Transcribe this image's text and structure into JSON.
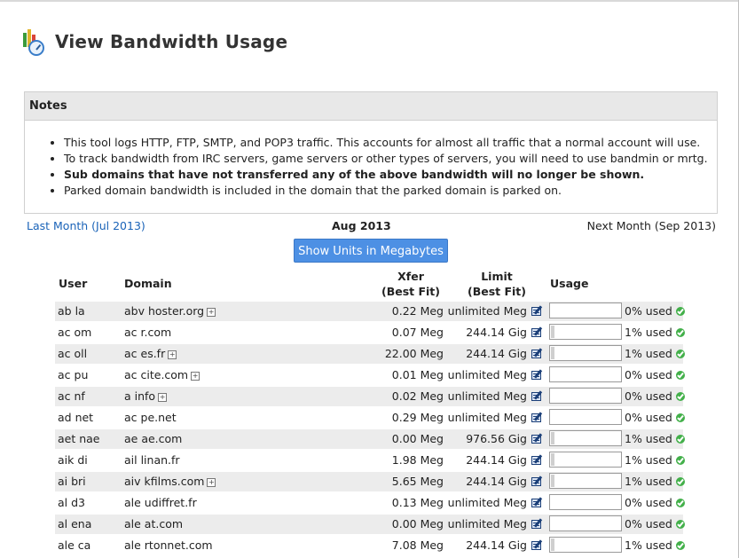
{
  "page": {
    "title": "View Bandwidth Usage",
    "icon": "bandwidth-gauge-icon"
  },
  "notes": {
    "heading": "Notes",
    "items": [
      {
        "text": "This tool logs HTTP, FTP, SMTP, and POP3 traffic. This accounts for almost all traffic that a normal account will use.",
        "bold": false
      },
      {
        "text": "To track bandwidth from IRC servers, game servers or other types of servers, you will need to use bandmin or mrtg.",
        "bold": false
      },
      {
        "text": "Sub domains that have not transferred any of the above bandwidth will no longer be shown.",
        "bold": true
      },
      {
        "text": "Parked domain bandwidth is included in the domain that the parked domain is parked on.",
        "bold": false
      }
    ]
  },
  "month_nav": {
    "prev": "Last Month (Jul 2013)",
    "current": "Aug 2013",
    "next": "Next Month (Sep 2013)"
  },
  "units_button": "Show Units in Megabytes",
  "table": {
    "headers": {
      "user": "User",
      "domain": "Domain",
      "xfer_line1": "Xfer",
      "xfer_line2": "(Best Fit)",
      "limit_line1": "Limit",
      "limit_line2": "(Best Fit)",
      "usage": "Usage"
    },
    "rows": [
      {
        "user": "ab      la",
        "domain": "abv                hoster.org",
        "expandable": true,
        "xfer": "0.22 Meg",
        "limit": "unlimited Meg",
        "usage_fraction": 0.0,
        "pct": "0% used"
      },
      {
        "user": "ac      om",
        "domain": "ac      r.com",
        "expandable": false,
        "xfer": "0.07 Meg",
        "limit": "244.14 Gig",
        "usage_fraction": 0.01,
        "pct": "1% used"
      },
      {
        "user": "ac      oll",
        "domain": "ac            es.fr",
        "expandable": true,
        "xfer": "22.00 Meg",
        "limit": "244.14 Gig",
        "usage_fraction": 0.01,
        "pct": "1% used"
      },
      {
        "user": "ac      pu",
        "domain": "ac              cite.com",
        "expandable": true,
        "xfer": "0.01 Meg",
        "limit": "unlimited Meg",
        "usage_fraction": 0.0,
        "pct": "0% used"
      },
      {
        "user": "ac      nf",
        "domain": "a          info",
        "expandable": true,
        "xfer": "0.02 Meg",
        "limit": "unlimited Meg",
        "usage_fraction": 0.0,
        "pct": "0% used"
      },
      {
        "user": "ad      net",
        "domain": "ac     pe.net",
        "expandable": false,
        "xfer": "0.29 Meg",
        "limit": "unlimited Meg",
        "usage_fraction": 0.0,
        "pct": "0% used"
      },
      {
        "user": "aet      nae",
        "domain": "ae      ae.com",
        "expandable": false,
        "xfer": "0.00 Meg",
        "limit": "976.56 Gig",
        "usage_fraction": 0.01,
        "pct": "1% used"
      },
      {
        "user": "aik      di",
        "domain": "ail        linan.fr",
        "expandable": false,
        "xfer": "1.98 Meg",
        "limit": "244.14 Gig",
        "usage_fraction": 0.01,
        "pct": "1% used"
      },
      {
        "user": "ai      bri",
        "domain": "aiv             kfilms.com",
        "expandable": true,
        "xfer": "5.65 Meg",
        "limit": "244.14 Gig",
        "usage_fraction": 0.01,
        "pct": "1% used"
      },
      {
        "user": "al      d3",
        "domain": "ale               udiffret.fr",
        "expandable": false,
        "xfer": "0.13 Meg",
        "limit": "unlimited Meg",
        "usage_fraction": 0.0,
        "pct": "0% used"
      },
      {
        "user": "al      ena",
        "domain": "ale         at.com",
        "expandable": false,
        "xfer": "0.00 Meg",
        "limit": "unlimited Meg",
        "usage_fraction": 0.0,
        "pct": "0% used"
      },
      {
        "user": "ale      ca",
        "domain": "ale          rtonnet.com",
        "expandable": false,
        "xfer": "7.08 Meg",
        "limit": "244.14 Gig",
        "usage_fraction": 0.01,
        "pct": "1% used"
      }
    ]
  }
}
